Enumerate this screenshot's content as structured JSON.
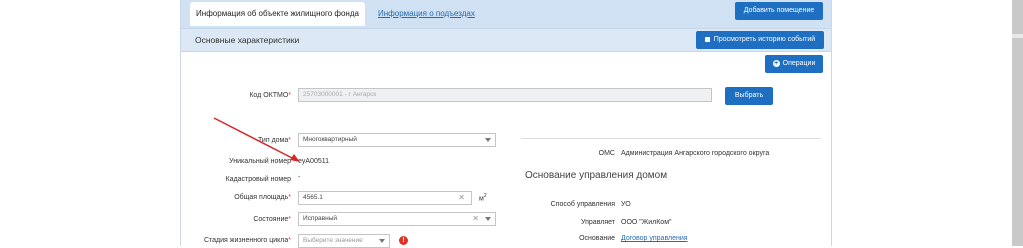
{
  "tabs": {
    "active": "Информация об объекте жилищного фонда",
    "entrances": "Информация о подъездах"
  },
  "buttons": {
    "add_room": "Добавить помещение",
    "history": "Просмотреть историю событий",
    "operations": "Операции",
    "select": "Выбрать"
  },
  "section": {
    "main_title": "Основные характеристики",
    "management_title": "Основание управления домом"
  },
  "form": {
    "oktmo_label": "Код ОКТМО",
    "oktmo_value": "25703000001 - г Ангарск",
    "house_type_label": "Тип дома",
    "house_type_value": "Многоквартирный",
    "unique_label": "Уникальный номер",
    "unique_value": "eyA00511",
    "cadastral_label": "Кадастровый номер",
    "cadastral_value": "-",
    "area_label": "Общая площадь",
    "area_value": "4565.1",
    "area_unit": "м",
    "area_sup": "2",
    "state_label": "Состояние",
    "state_value": "Исправный",
    "lifecycle_label": "Стадия жизненного цикла",
    "lifecycle_placeholder": "Выберите значение",
    "required_mark": "*"
  },
  "info": {
    "oms_label": "ОМС",
    "oms_value": "Администрация Ангарского городского округа",
    "method_label": "Способ управления",
    "method_value": "УО",
    "manager_label": "Управляет",
    "manager_value": "ООО \"ЖилКом\"",
    "basis_label": "Основание",
    "basis_value": "Договор управления"
  },
  "colors": {
    "primary": "#1e6fc2",
    "header_bg": "#dce8f5",
    "tabbar_bg": "#cfe1f3",
    "annotation_arrow": "#d42a2a"
  },
  "icons": {
    "history": "square-icon",
    "operations": "plus-circle-icon",
    "warning": "exclamation-circle-icon"
  }
}
